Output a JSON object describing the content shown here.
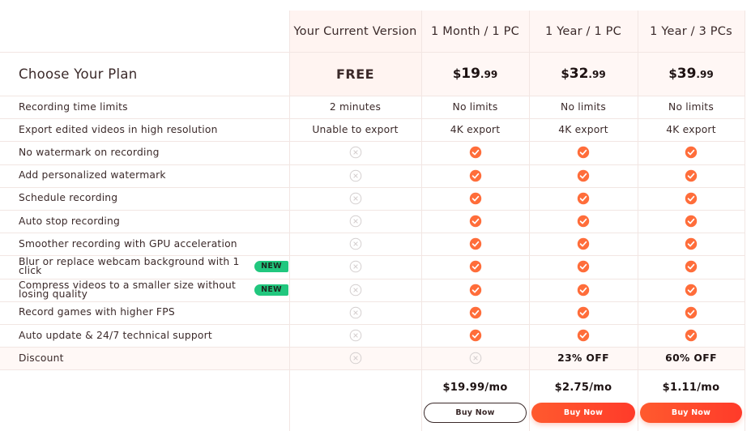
{
  "header": {
    "plan_title": "Choose Your Plan",
    "columns": [
      "Your Current Version",
      "1 Month / 1 PC",
      "1 Year / 1 PC",
      "1 Year / 3 PCs"
    ]
  },
  "prices": {
    "free": "FREE",
    "paid": [
      {
        "currency": "$",
        "int": "19",
        "cents": ".99"
      },
      {
        "currency": "$",
        "int": "32",
        "cents": ".99"
      },
      {
        "currency": "$",
        "int": "39",
        "cents": ".99"
      }
    ]
  },
  "features": [
    {
      "label": "Recording time limits",
      "values": [
        "2 minutes",
        "No limits",
        "No limits",
        "No limits"
      ]
    },
    {
      "label": "Export edited videos in high resolution",
      "values": [
        "Unable to export",
        "4K export",
        "4K export",
        "4K export"
      ]
    },
    {
      "label": "No watermark on recording",
      "values": [
        "x",
        "check",
        "check",
        "check"
      ]
    },
    {
      "label": "Add personalized watermark",
      "values": [
        "x",
        "check",
        "check",
        "check"
      ]
    },
    {
      "label": "Schedule recording",
      "values": [
        "x",
        "check",
        "check",
        "check"
      ]
    },
    {
      "label": "Auto stop recording",
      "values": [
        "x",
        "check",
        "check",
        "check"
      ]
    },
    {
      "label": "Smoother recording with GPU acceleration",
      "values": [
        "x",
        "check",
        "check",
        "check"
      ]
    },
    {
      "label": "Blur or replace webcam background with 1 click",
      "badge": "NEW",
      "values": [
        "x",
        "check",
        "check",
        "check"
      ]
    },
    {
      "label": "Compress videos to a smaller size without losing quality",
      "badge": "NEW",
      "values": [
        "x",
        "check",
        "check",
        "check"
      ]
    },
    {
      "label": "Record games with higher FPS",
      "values": [
        "x",
        "check",
        "check",
        "check"
      ]
    },
    {
      "label": "Auto update & 24/7 technical support",
      "values": [
        "x",
        "check",
        "check",
        "check"
      ]
    },
    {
      "label": "Discount",
      "values": [
        "x",
        "x",
        "23% OFF",
        "60% OFF"
      ]
    }
  ],
  "footer": {
    "monthly": [
      "$19.99/mo",
      "$2.75/mo",
      "$1.11/mo"
    ],
    "buy_label": "Buy Now"
  },
  "colors": {
    "accent": "#ff5a2e",
    "check": "#ff6d3a",
    "badge": "#21c77e",
    "header_bg": "#fff4f1"
  },
  "icons": {
    "included": "check-circle-icon",
    "excluded": "x-circle-icon"
  }
}
